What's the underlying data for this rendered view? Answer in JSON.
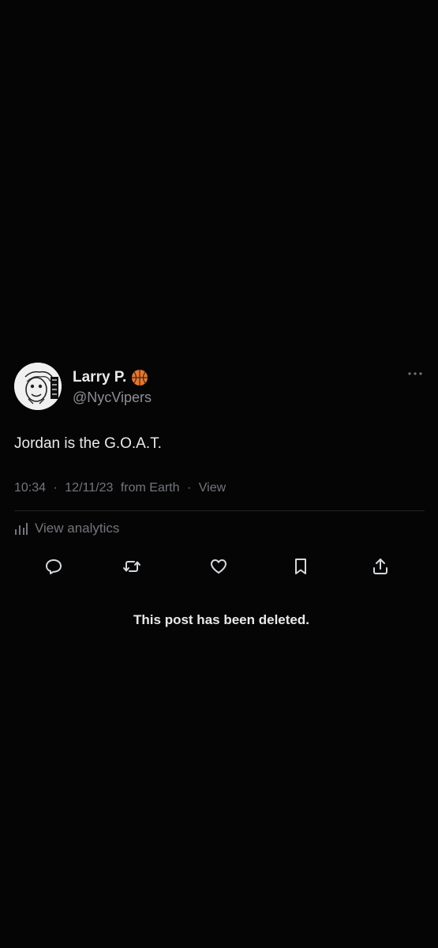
{
  "tweet": {
    "display_name": "Larry P.",
    "name_emoji": "basketball-emoji",
    "handle": "@NycVipers",
    "text": "Jordan is the G.O.A.T.",
    "time": "10:34",
    "date": "12/11/23",
    "source": "from Earth",
    "views_label": "View",
    "separator": "·",
    "analytics_label": "View analytics"
  },
  "actions": [
    {
      "name": "reply",
      "icon": "reply-icon"
    },
    {
      "name": "retweet",
      "icon": "retweet-icon"
    },
    {
      "name": "like",
      "icon": "heart-icon"
    },
    {
      "name": "bookmark",
      "icon": "bookmark-icon"
    },
    {
      "name": "share",
      "icon": "share-icon"
    }
  ],
  "notice": {
    "text": "This post has been deleted."
  },
  "colors": {
    "background": "#050505",
    "primary_text": "#e7e9ea",
    "secondary_text": "#72767b",
    "basketball": "#e8772e"
  }
}
